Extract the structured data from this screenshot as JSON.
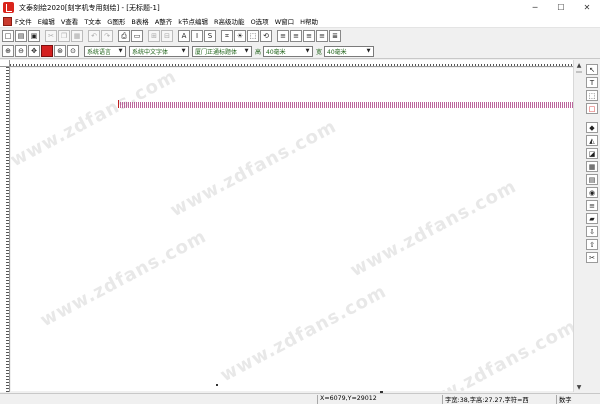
{
  "window": {
    "title": "文泰刻绘2020[刻字机专用刻绘] - [无标题-1]",
    "controls": {
      "minimize": "─",
      "maximize": "☐",
      "close": "✕"
    }
  },
  "menu": [
    "F文件",
    "E编辑",
    "V查看",
    "T文本",
    "G图形",
    "B表格",
    "A整齐",
    "k节点编辑",
    "R高级功能",
    "O选项",
    "W窗口",
    "H帮助"
  ],
  "toolbar1": {
    "icons": [
      "new-icon",
      "open-icon",
      "save-icon",
      "cut-icon",
      "copy-icon",
      "paste-icon",
      "undo-icon",
      "redo-icon",
      "print-icon",
      "preview-icon",
      "group-icon",
      "ungroup-icon",
      "bold-icon",
      "italic-icon",
      "vertical-text-icon",
      "crop-icon",
      "bulb-icon",
      "dashed-rect-icon",
      "rotate-icon",
      "align-left-icon",
      "align-center-icon",
      "align-right-icon",
      "align-justify-icon",
      "align-distribute-icon"
    ],
    "glyphs": [
      "□",
      "▤",
      "▣",
      "✂",
      "❐",
      "▦",
      "↶",
      "↷",
      "⎙",
      "▭",
      "⊞",
      "⊟",
      "A",
      "I",
      "S",
      "⌗",
      "☀",
      "⬚",
      "⟲",
      "≡",
      "≡",
      "≡",
      "≡",
      "≣"
    ]
  },
  "toolbar2": {
    "icons": [
      "zoom-in-icon",
      "zoom-out-icon",
      "pan-icon",
      "color-icon",
      "zoom-fit-icon",
      "zoom-page-icon"
    ],
    "glyphs": [
      "⊕",
      "⊖",
      "✥",
      "",
      "⊛",
      "⊙"
    ],
    "language_select": "系统语言",
    "chinese_font_select": "系统中文字体",
    "english_font_select": "厦门正通标题体",
    "height_label": "高",
    "height_value": "40毫米",
    "width_label": "宽",
    "width_value": "40毫米"
  },
  "right_tools": {
    "icons": [
      "pointer-icon",
      "text-tool-icon",
      "shape-edit-icon",
      "rectangle-icon",
      "fill-icon",
      "stroke-icon",
      "shadow-icon",
      "table-icon",
      "layer-icon",
      "paint-icon",
      "line-icon",
      "gradient-icon",
      "import-icon",
      "export-icon",
      "cut-path-icon"
    ],
    "glyphs": [
      "↖",
      "T",
      "⬚",
      "□",
      "◆",
      "◭",
      "◪",
      "▦",
      "▤",
      "◉",
      "≡",
      "▰",
      "⇩",
      "⇧",
      "✂"
    ]
  },
  "watermark": "www.zdfans.com",
  "statusbar": {
    "coords": "X=6079,Y=29012",
    "font_info": "字宽:38,字高:27.27,字符=西",
    "mode": "数字"
  },
  "colors": {
    "accent_red": "#d42020",
    "text_green": "#20631a",
    "baseline_magenta": "#b04a8a"
  }
}
